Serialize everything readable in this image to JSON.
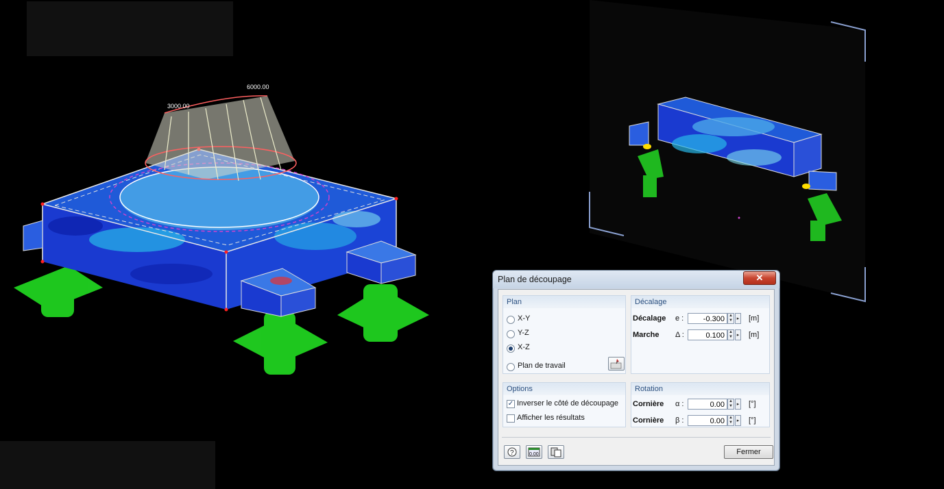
{
  "viewport": {
    "load_labels": [
      "3000.00",
      "6000.00"
    ]
  },
  "dialog": {
    "title": "Plan de découpage",
    "close_glyph": "✕",
    "plan": {
      "header": "Plan",
      "options": [
        "X-Y",
        "Y-Z",
        "X-Z",
        "Plan de travail"
      ],
      "selected": "X-Z"
    },
    "decalage": {
      "header": "Décalage",
      "rows": [
        {
          "label": "Décalage",
          "symbol": "e :",
          "value": "-0.300",
          "unit": "[m]"
        },
        {
          "label": "Marche",
          "symbol": "Δ :",
          "value": "0.100",
          "unit": "[m]"
        }
      ]
    },
    "options": {
      "header": "Options",
      "items": [
        {
          "label": "Inverser le côté de découpage",
          "checked": true
        },
        {
          "label": "Afficher les résultats",
          "checked": false
        }
      ]
    },
    "rotation": {
      "header": "Rotation",
      "rows": [
        {
          "label": "Cornière",
          "symbol": "α :",
          "value": "0.00",
          "unit": "[°]"
        },
        {
          "label": "Cornière",
          "symbol": "β :",
          "value": "0.00",
          "unit": "[°]"
        }
      ]
    },
    "buttons": {
      "close": "Fermer",
      "icons": [
        "help-icon",
        "units-icon",
        "copy-icon"
      ]
    }
  }
}
